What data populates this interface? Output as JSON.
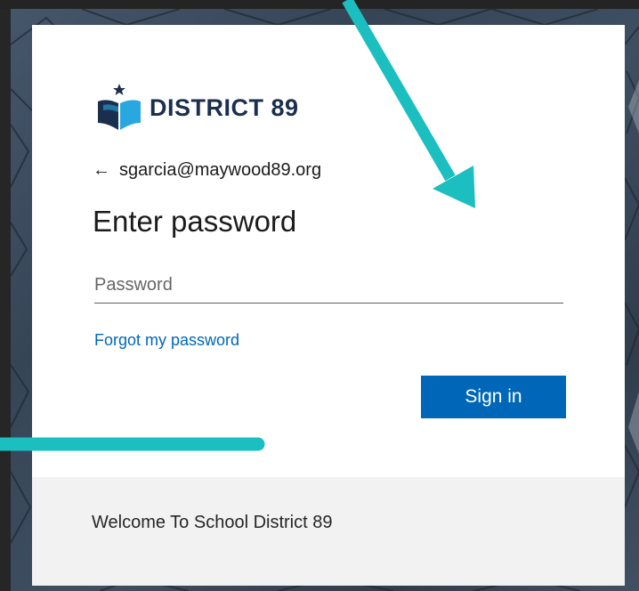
{
  "brand": {
    "logo_text": "DISTRICT 89",
    "colors": {
      "navy": "#1a2f4e",
      "sky": "#29a8e0",
      "teal": "#1bbfbf"
    }
  },
  "identity": {
    "back_icon": "arrow-left-icon",
    "back_glyph": "←",
    "email": "sgarcia@maywood89.org"
  },
  "form": {
    "title": "Enter password",
    "password_placeholder": "Password",
    "password_value": "",
    "forgot_link": "Forgot my password",
    "submit_label": "Sign in"
  },
  "footer": {
    "text": "Welcome To School District 89"
  },
  "theme": {
    "accent": "#0067b8",
    "annotation_color": "#1bbfbf"
  }
}
